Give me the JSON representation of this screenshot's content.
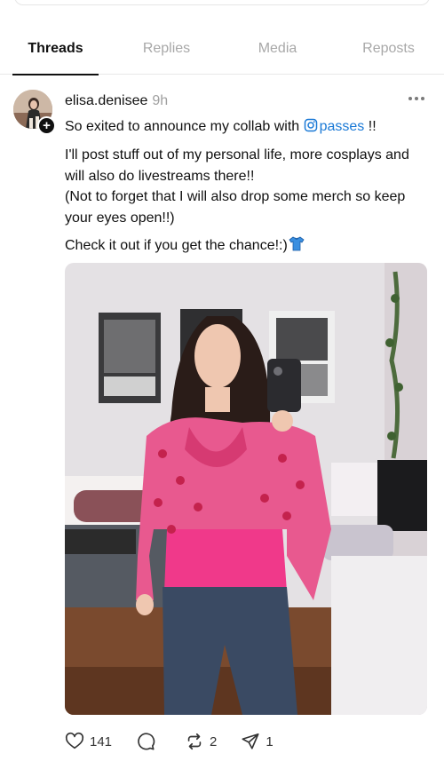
{
  "tabs": [
    {
      "label": "Threads",
      "active": true
    },
    {
      "label": "Replies",
      "active": false
    },
    {
      "label": "Media",
      "active": false
    },
    {
      "label": "Reposts",
      "active": false
    }
  ],
  "post": {
    "username": "elisa.denisee",
    "time": "9h",
    "line1_prefix": "So exited to announce my collab with",
    "mention": "passes",
    "line1_suffix": " !!",
    "para2_line1": "I'll post stuff out of my personal life, more cosplays and will also do livestreams there!!",
    "para2_line2": "(Not to forget that I will also drop some merch so keep your eyes open!!)",
    "para3": "Check it out if you get the chance!:)",
    "emoji_icon": "shirt-emoji-icon",
    "actions": {
      "likes": "141",
      "comments": "",
      "reposts": "2",
      "shares": "1"
    }
  },
  "colors": {
    "accent_link": "#1a79d6",
    "tab_active": "#101010",
    "tab_inactive": "#a8a8a8",
    "jacket_pink": "#e8598f",
    "top_pink": "#f0398a"
  }
}
